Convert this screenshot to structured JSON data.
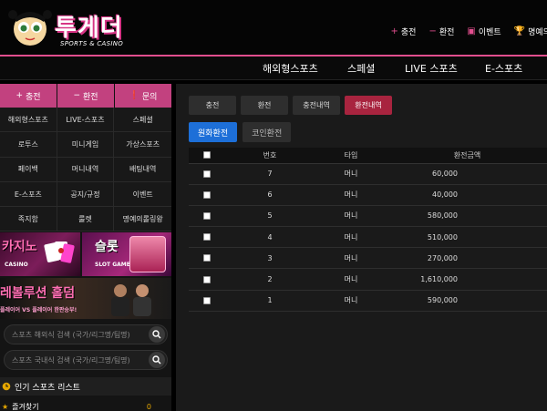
{
  "header": {
    "logo_title": "투게더",
    "logo_subtitle": "SPORTS & CASINO",
    "links": [
      {
        "icon": "plus-icon",
        "glyph": "+",
        "label": "충전"
      },
      {
        "icon": "minus-icon",
        "glyph": "−",
        "label": "환전"
      },
      {
        "icon": "calendar-icon",
        "glyph": "▣",
        "label": "이벤트"
      },
      {
        "icon": "trophy-icon",
        "glyph": "🏆",
        "label": "명예의"
      }
    ]
  },
  "mainnav": [
    "해외형스포츠",
    "스페셜",
    "LIVE 스포츠",
    "E-스포츠"
  ],
  "sidebar": {
    "top_buttons": [
      {
        "icon": "plus-icon",
        "glyph": "+",
        "label": "충전"
      },
      {
        "icon": "minus-icon",
        "glyph": "−",
        "label": "환전"
      },
      {
        "icon": "info-icon",
        "glyph": "❗",
        "label": "문의"
      }
    ],
    "menu": [
      "해외형스포츠",
      "LIVE-스포츠",
      "스페셜",
      "로투스",
      "미니게임",
      "가상스포츠",
      "페이백",
      "머니내역",
      "배팅내역",
      "E-스포츠",
      "공지/규정",
      "이벤트",
      "족지함",
      "룰렛",
      "명예의롤링왕"
    ],
    "banners": {
      "casino_title": "카지노",
      "casino_sub": "CASINO",
      "slot_title": "슬롯",
      "slot_sub": "SLOT GAME",
      "evo_title": "레볼루션 홀덤",
      "evo_sub": "플레이어 VS 플레이어 한판승부!"
    },
    "search": [
      {
        "placeholder": "스포츠 해외식 검색 (국가/리그명/팀명)"
      },
      {
        "placeholder": "스포츠 국내식 검색 (국가/리그명/팀명)"
      }
    ],
    "popular_title": "인기 스포츠 리스트",
    "favorites": {
      "label": "즐겨찾기",
      "count": "0"
    }
  },
  "content": {
    "tabs": [
      "충전",
      "환전",
      "충전내역",
      "환전내역"
    ],
    "active_tab": "환전내역",
    "subtabs": [
      "원화환전",
      "코인환전"
    ],
    "table": {
      "headers": [
        "",
        "번호",
        "타입",
        "환전금액"
      ],
      "rows": [
        {
          "no": "7",
          "type": "머니",
          "amount": "60,000"
        },
        {
          "no": "6",
          "type": "머니",
          "amount": "40,000"
        },
        {
          "no": "5",
          "type": "머니",
          "amount": "580,000"
        },
        {
          "no": "4",
          "type": "머니",
          "amount": "510,000"
        },
        {
          "no": "3",
          "type": "머니",
          "amount": "270,000"
        },
        {
          "no": "2",
          "type": "머니",
          "amount": "1,610,000"
        },
        {
          "no": "1",
          "type": "머니",
          "amount": "590,000"
        }
      ]
    }
  },
  "colors": {
    "accent": "#e24e8e",
    "sidebar_btn": "#c2417f",
    "active_tab": "#a8243f",
    "blue": "#1d6fd8"
  }
}
